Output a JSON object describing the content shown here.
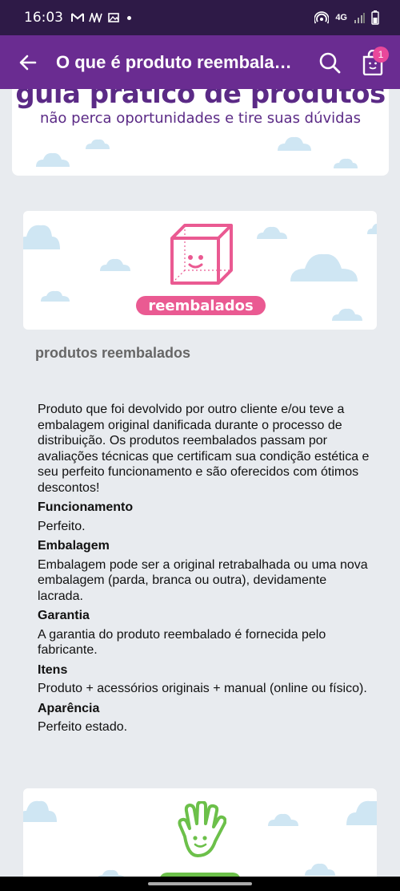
{
  "status_bar": {
    "time": "16:03",
    "network": "4G"
  },
  "app_bar": {
    "title": "O que é produto reembala…",
    "cart_count": "1"
  },
  "top_banner": {
    "title": "guia prático de produtos",
    "subtitle": "não perca oportunidades e tire suas dúvidas"
  },
  "reembalados_banner": {
    "label": "reembalados"
  },
  "section_title": "produtos reembalados",
  "content": {
    "intro": "Produto que foi devolvido por outro cliente e/ou teve a embalagem original danificada durante o processo de distribuição. Os produtos reembalados passam por avaliações técnicas que certificam sua condição estética e seu perfeito funcionamento e são oferecidos com ótimos descontos!",
    "items": [
      {
        "heading": "Funcionamento",
        "text": "Perfeito."
      },
      {
        "heading": "Embalagem",
        "text": "Embalagem pode ser a original retrabalhada ou uma nova embalagem (parda, branca ou outra), devidamente lacrada."
      },
      {
        "heading": "Garantia",
        "text": "A garantia do produto reembalado é fornecida pelo fabricante."
      },
      {
        "heading": "Itens",
        "text": "Produto + acessórios originais + manual (online ou físico)."
      },
      {
        "heading": "Aparência",
        "text": "Perfeito estado."
      }
    ]
  },
  "colors": {
    "status_bar": "#2e1a47",
    "app_bar": "#6a2c91",
    "brand_purple": "#5b2a86",
    "pink": "#ea5a92",
    "green": "#6cc04a",
    "cloud": "#cfe6f3"
  },
  "icons": [
    "back-arrow-icon",
    "search-icon",
    "shopping-bag-icon",
    "box-icon",
    "hand-icon"
  ]
}
